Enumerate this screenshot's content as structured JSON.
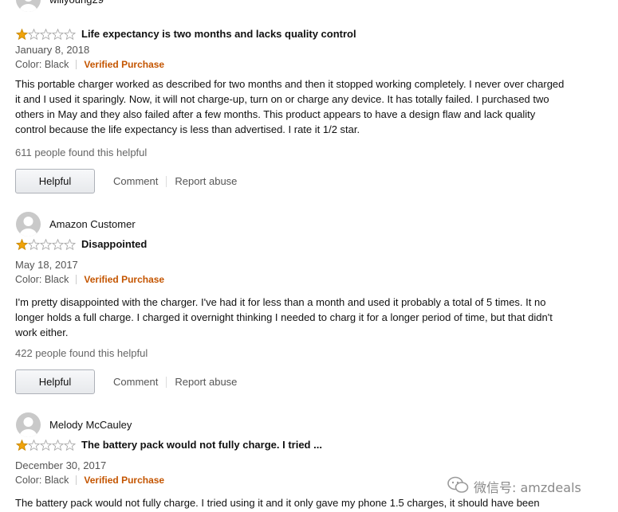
{
  "reviews": [
    {
      "reviewer": "willyoung29",
      "rating": 1,
      "title": "Life expectancy is two months and lacks quality control",
      "date": "January 8, 2018",
      "color": "Color: Black",
      "verified": "Verified Purchase",
      "body": "This portable charger worked as described for two months and then it stopped working completely. I never over charged it and I used it sparingly. Now, it will not charge-up, turn on or charge any device. It has totally failed. I purchased two others in May and they also failed after a few months. This product appears to have a design flaw and lack quality control because the life expectancy is less than advertised. I rate it 1/2 star.",
      "helpful_count": "611 people found this helpful",
      "helpful_label": "Helpful",
      "comment_label": "Comment",
      "report_label": "Report abuse"
    },
    {
      "reviewer": "Amazon Customer",
      "rating": 1,
      "title": "Disappointed",
      "date": "May 18, 2017",
      "color": "Color: Black",
      "verified": "Verified Purchase",
      "body": "I'm pretty disappointed with the charger. I've had it for less than a month and used it probably a total of 5 times. It no longer holds a full charge. I charged it overnight thinking I needed to charg it for a longer period of time, but that didn't work either.",
      "helpful_count": "422 people found this helpful",
      "helpful_label": "Helpful",
      "comment_label": "Comment",
      "report_label": "Report abuse"
    },
    {
      "reviewer": "Melody McCauley",
      "rating": 1,
      "title": "The battery pack would not fully charge. I tried ...",
      "date": "December 30, 2017",
      "color": "Color: Black",
      "verified": "Verified Purchase",
      "body": "The battery pack would not fully charge. I tried using it and it only gave my phone 1.5 charges, it should have been"
    }
  ],
  "watermark": {
    "text": "微信号: amzdeals",
    "icon": "wechat-icon"
  },
  "colors": {
    "star": "#f0a30a",
    "verified": "#c45500",
    "avatar": "#c9c9c9"
  }
}
